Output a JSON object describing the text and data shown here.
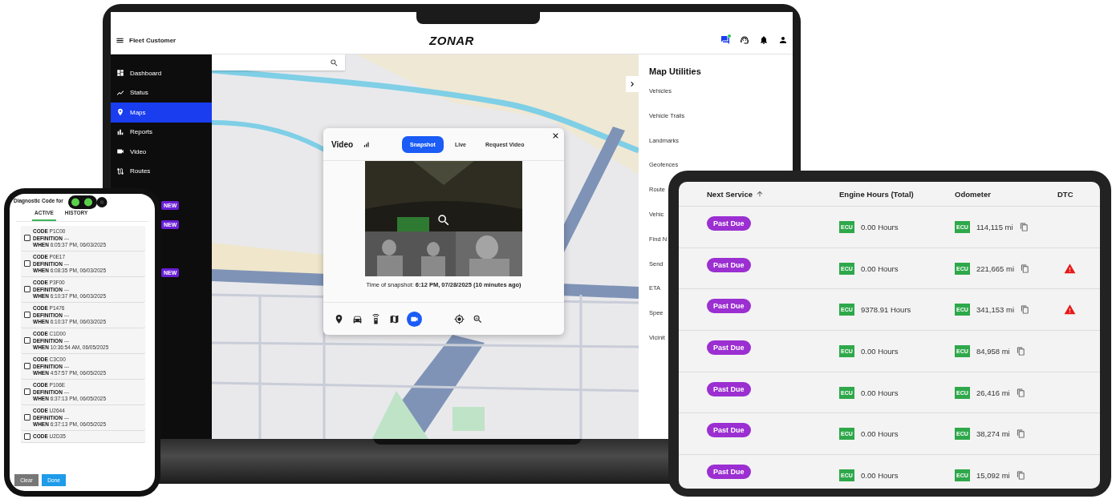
{
  "laptop": {
    "header": {
      "account": "Fleet Customer",
      "logo": "ZONAR",
      "chat_unread": true
    },
    "sidebar": {
      "items": [
        {
          "label": "Dashboard",
          "selected": false
        },
        {
          "label": "Status",
          "selected": false
        },
        {
          "label": "Maps",
          "selected": true
        },
        {
          "label": "Reports",
          "selected": false
        },
        {
          "label": "Video",
          "selected": false
        },
        {
          "label": "Routes",
          "selected": false
        }
      ],
      "badges": [
        "NEW",
        "NEW",
        "NEW"
      ]
    },
    "video_panel": {
      "title": "Video",
      "tabs": [
        {
          "label": "Snapshot",
          "selected": true
        },
        {
          "label": "Live",
          "selected": false
        },
        {
          "label": "Request Video",
          "selected": false
        }
      ],
      "snapshot_time": "Time of snapshot: **6:12 PM, 07/28/2025 (10 minutes ago)**",
      "tools": [
        {
          "selected": false
        },
        {
          "selected": false
        },
        {
          "selected": false
        },
        {
          "selected": false
        },
        {
          "selected": true
        },
        {
          "selected": false
        },
        {
          "selected": false
        }
      ]
    },
    "map_utilities": {
      "title": "Map Utilities",
      "items": [
        "Vehicles",
        "Vehicle Trails",
        "Landmarks",
        "Geofences",
        "Route",
        "Vehic",
        "Find N",
        "Send",
        "ETA",
        "Spee",
        "Vicinit"
      ]
    }
  },
  "phone": {
    "title": "Diagnostic Code for",
    "tabs": [
      {
        "label": "ACTIVE",
        "selected": true
      },
      {
        "label": "HISTORY",
        "selected": false
      }
    ],
    "codes": [
      {
        "lines": [
          "**CODE** P1C00",
          "**DEFINITION** ---",
          "**WHEN** 6:05:37 PM, 06/03/2025"
        ],
        "checked": false
      },
      {
        "lines": [
          "**CODE** P0E17",
          "**DEFINITION** ---",
          "**WHEN** 6:08:35 PM, 06/03/2025"
        ],
        "checked": false
      },
      {
        "lines": [
          "**CODE** P3F00",
          "**DEFINITION** ---",
          "**WHEN** 6:10:37 PM, 06/03/2025"
        ],
        "checked": false
      },
      {
        "lines": [
          "**CODE** P1476",
          "**DEFINITION** ---",
          "**WHEN** 6:10:37 PM, 06/03/2025"
        ],
        "checked": false
      },
      {
        "lines": [
          "**CODE** C1D00",
          "**DEFINITION** ---",
          "**WHEN** 10:36:54 AM, 06/05/2025"
        ],
        "checked": false
      },
      {
        "lines": [
          "**CODE** C3C00",
          "**DEFINITION** ---",
          "**WHEN** 4:57:57 PM, 06/05/2025"
        ],
        "checked": false
      },
      {
        "lines": [
          "**CODE** P106E",
          "**DEFINITION** ---",
          "**WHEN** 6:37:13 PM, 06/05/2025"
        ],
        "checked": false
      },
      {
        "lines": [
          "**CODE** U2644",
          "**DEFINITION** ---",
          "**WHEN** 6:37:13 PM, 06/05/2025"
        ],
        "checked": false
      },
      {
        "lines": [
          "**CODE** U2D35"
        ],
        "checked": false
      }
    ],
    "buttons": [
      "Clear",
      "Done"
    ]
  },
  "tablet": {
    "columns": [
      "Next Service",
      "Engine Hours (Total)",
      "Odometer",
      "DTC"
    ],
    "rows": [
      {
        "status": "Past Due",
        "engine_source": "ECU",
        "engine_hours": "0.00 Hours",
        "odometer_source": "ECU",
        "odometer": "114,115 mi",
        "dtc_alert": false
      },
      {
        "status": "Past Due",
        "engine_source": "ECU",
        "engine_hours": "0.00 Hours",
        "odometer_source": "ECU",
        "odometer": "221,665 mi",
        "dtc_alert": true
      },
      {
        "status": "Past Due",
        "engine_source": "ECU",
        "engine_hours": "9378.91 Hours",
        "odometer_source": "ECU",
        "odometer": "341,153 mi",
        "dtc_alert": true
      },
      {
        "status": "Past Due",
        "engine_source": "ECU",
        "engine_hours": "0.00 Hours",
        "odometer_source": "ECU",
        "odometer": "84,958 mi",
        "dtc_alert": false
      },
      {
        "status": "Past Due",
        "engine_source": "ECU",
        "engine_hours": "0.00 Hours",
        "odometer_source": "ECU",
        "odometer": "26,416 mi",
        "dtc_alert": false
      },
      {
        "status": "Past Due",
        "engine_source": "ECU",
        "engine_hours": "0.00 Hours",
        "odometer_source": "ECU",
        "odometer": "38,274 mi",
        "dtc_alert": false
      },
      {
        "status": "Past Due",
        "engine_source": "ECU",
        "engine_hours": "0.00 Hours",
        "odometer_source": "ECU",
        "odometer": "15,092 mi",
        "dtc_alert": false
      }
    ]
  }
}
